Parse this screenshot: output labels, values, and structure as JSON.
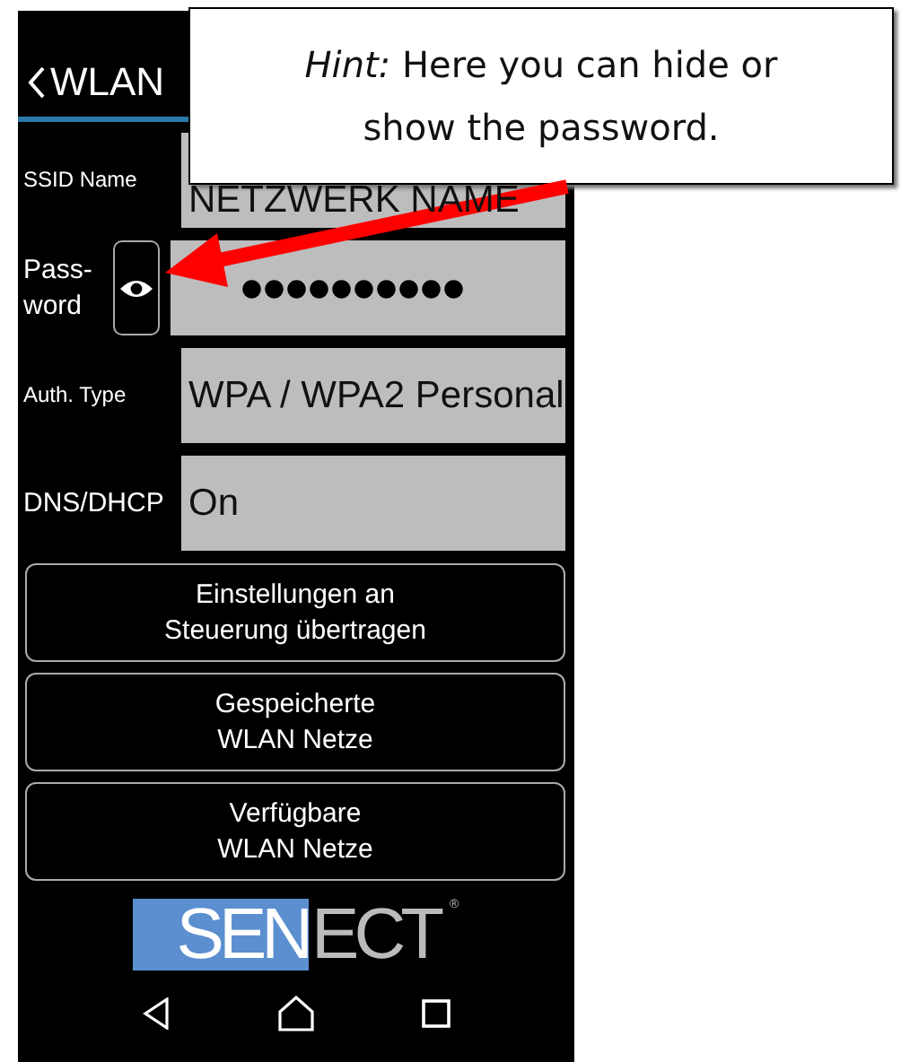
{
  "header": {
    "title": "WLAN"
  },
  "fields": [
    {
      "kind": "text",
      "label": "SSID Name",
      "value": "NETZWERK NAME"
    },
    {
      "kind": "password",
      "label": "Pass-\nword",
      "value": "●●●●●●●●●●"
    },
    {
      "kind": "text",
      "label": "Auth. Type",
      "value": "WPA / WPA2 Personal"
    },
    {
      "kind": "text",
      "label": "DNS/DHCP",
      "value": "On"
    }
  ],
  "buttons": [
    "Einstellungen an\nSteuerung übertragen",
    "Gespeicherte\nWLAN Netze",
    "Verfügbare\nWLAN Netze"
  ],
  "logo": {
    "left": "SEN",
    "right": "ECT",
    "mark": "®"
  },
  "callout": {
    "text": "*Hint:* Here you can hide or show the password."
  }
}
